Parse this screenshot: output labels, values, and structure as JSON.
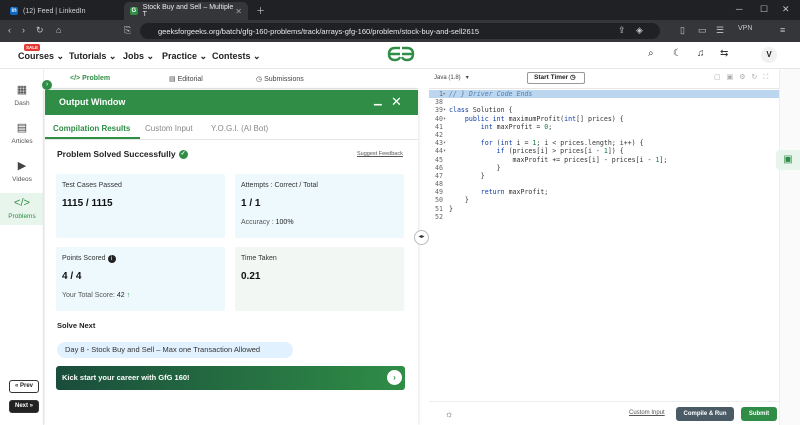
{
  "browser": {
    "tabs": [
      {
        "label": "(12) Feed | LinkedIn",
        "icon": "linkedin-icon",
        "color": "#0a66c2"
      },
      {
        "label": "Stock Buy and Sell – Multiple T",
        "icon": "gfg-icon",
        "color": "#2f8d46"
      }
    ],
    "url": "geeksforgeeks.org/batch/gfg-160-problems/track/arrays-gfg-160/problem/stock-buy-and-sell2615",
    "vpn_label": "VPN"
  },
  "header": {
    "sale_badge": "SALE",
    "nav": [
      "Courses",
      "Tutorials",
      "Jobs",
      "Practice",
      "Contests"
    ],
    "avatar": "V"
  },
  "rail": {
    "items": [
      {
        "label": "Dash",
        "icon": "dashboard-icon"
      },
      {
        "label": "Articles",
        "icon": "articles-icon"
      },
      {
        "label": "Videos",
        "icon": "videos-icon"
      },
      {
        "label": "Problems",
        "icon": "code-icon"
      }
    ],
    "prev": "« Prev",
    "next": "Next »"
  },
  "problem_tabs": [
    "Problem",
    "Editorial",
    "Submissions"
  ],
  "output": {
    "title": "Output Window",
    "tabs": [
      "Compilation Results",
      "Custom Input",
      "Y.O.G.I. (AI Bot)"
    ],
    "status": "Problem Solved Successfully",
    "suggest": "Suggest Feedback",
    "cards": {
      "test_label": "Test Cases Passed",
      "test_value": "1115 / 1115",
      "attempts_label": "Attempts : Correct / Total",
      "attempts_value": "1 / 1",
      "accuracy_label": "Accuracy :",
      "accuracy_value": "100%",
      "points_label": "Points Scored",
      "points_value": "4 / 4",
      "total_label": "Your Total Score:",
      "total_value": "42",
      "time_label": "Time Taken",
      "time_value": "0.21"
    },
    "solve_next": "Solve Next",
    "next_problem": "Day 8 - Stock Buy and Sell – Max one Transaction Allowed",
    "banner": "Kick start your career with GfG 160!"
  },
  "editor": {
    "language": "Java (1.8)",
    "timer": "Start Timer",
    "lines": [
      {
        "n": "1",
        "fold": "▸",
        "html": "<span class=\"cm\">// } Driver Code Ends</span>",
        "hl": true
      },
      {
        "n": "38",
        "fold": "",
        "html": ""
      },
      {
        "n": "39",
        "fold": "▾",
        "html": "<span class=\"kw\">class</span> Solution {"
      },
      {
        "n": "40",
        "fold": "▾",
        "html": "    <span class=\"kw\">public int</span> maximumProfit(<span class=\"kw\">int</span>[] prices) {"
      },
      {
        "n": "41",
        "fold": "",
        "html": "        <span class=\"kw\">int</span> maxProfit = <span class=\"num\">0</span>;"
      },
      {
        "n": "42",
        "fold": "",
        "html": ""
      },
      {
        "n": "43",
        "fold": "▾",
        "html": "        <span class=\"kw\">for</span> (<span class=\"kw\">int</span> i = <span class=\"num\">1</span>; i &lt; prices.length; i++) {"
      },
      {
        "n": "44",
        "fold": "▾",
        "html": "            <span class=\"kw\">if</span> (prices[i] &gt; prices[i - <span class=\"num\">1</span>]) {"
      },
      {
        "n": "45",
        "fold": "",
        "html": "                maxProfit += prices[i] - prices[i - <span class=\"num\">1</span>];"
      },
      {
        "n": "46",
        "fold": "",
        "html": "            }"
      },
      {
        "n": "47",
        "fold": "",
        "html": "        }"
      },
      {
        "n": "48",
        "fold": "",
        "html": ""
      },
      {
        "n": "49",
        "fold": "",
        "html": "        <span class=\"kw\">return</span> maxProfit;"
      },
      {
        "n": "50",
        "fold": "",
        "html": "    }"
      },
      {
        "n": "51",
        "fold": "",
        "html": "}"
      },
      {
        "n": "52",
        "fold": "",
        "html": ""
      }
    ],
    "custom_input": "Custom Input",
    "compile_run": "Compile & Run",
    "submit": "Submit"
  }
}
